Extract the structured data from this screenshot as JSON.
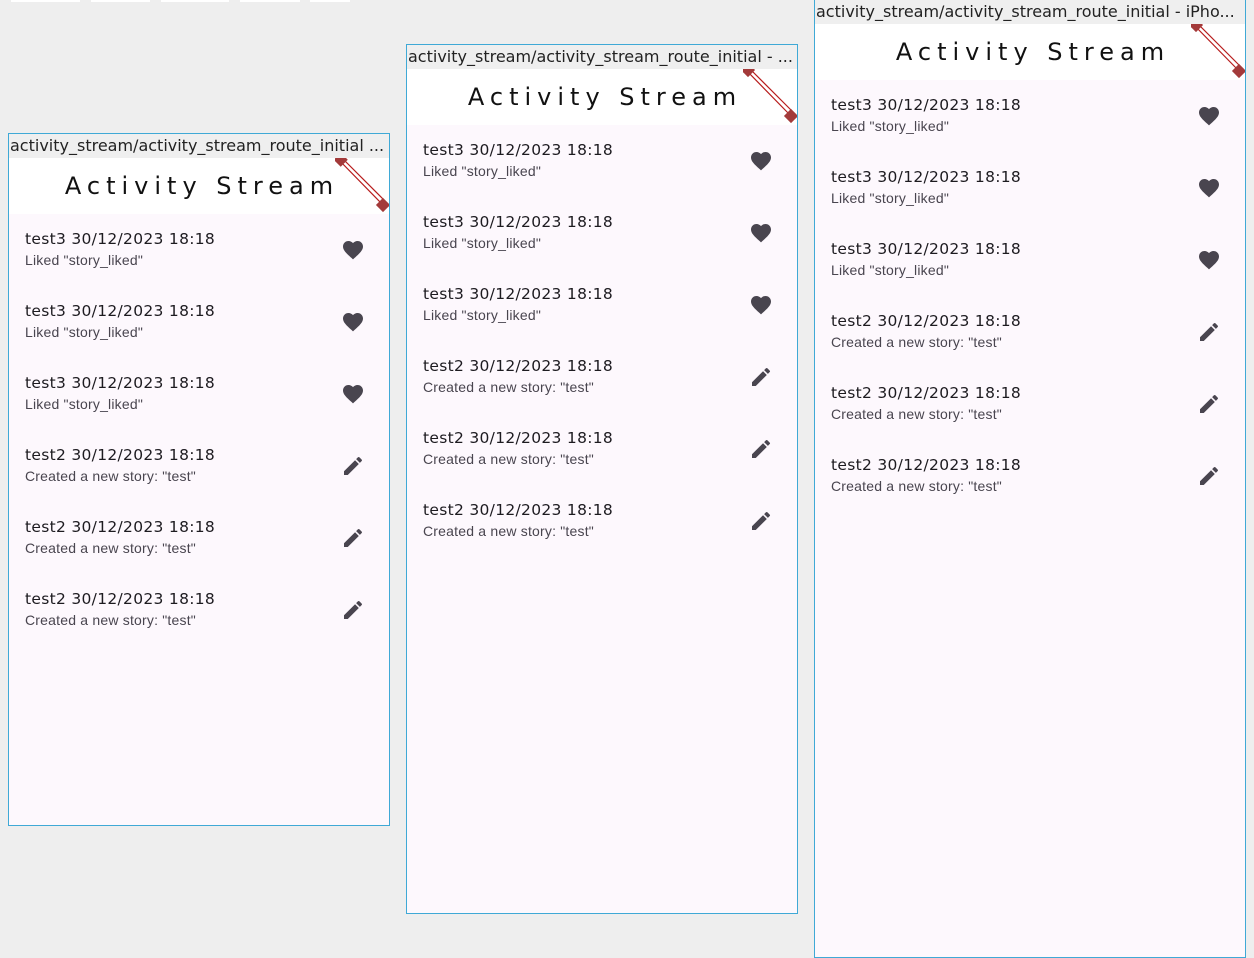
{
  "app_bar": {
    "title": "Activity Stream"
  },
  "devices": [
    {
      "label": "activity_stream/activity_stream_route_initial ..."
    },
    {
      "label": "activity_stream/activity_stream_route_initial - ..."
    },
    {
      "label": "activity_stream/activity_stream_route_initial - iPho..."
    }
  ],
  "items": [
    {
      "title": "test3 30/12/2023 18:18",
      "subtitle": "Liked \"story_liked\"",
      "icon": "heart-icon"
    },
    {
      "title": "test3 30/12/2023 18:18",
      "subtitle": "Liked \"story_liked\"",
      "icon": "heart-icon"
    },
    {
      "title": "test3 30/12/2023 18:18",
      "subtitle": "Liked \"story_liked\"",
      "icon": "heart-icon"
    },
    {
      "title": "test2 30/12/2023 18:18",
      "subtitle": "Created a new story: \"test\"",
      "icon": "pencil-icon"
    },
    {
      "title": "test2 30/12/2023 18:18",
      "subtitle": "Created a new story: \"test\"",
      "icon": "pencil-icon"
    },
    {
      "title": "test2 30/12/2023 18:18",
      "subtitle": "Created a new story: \"test\"",
      "icon": "pencil-icon"
    }
  ],
  "colors": {
    "frame_border": "#3fa9d6",
    "background": "#fdf8fd",
    "icon": "#49454f",
    "debug_banner": "#b71c1c"
  }
}
